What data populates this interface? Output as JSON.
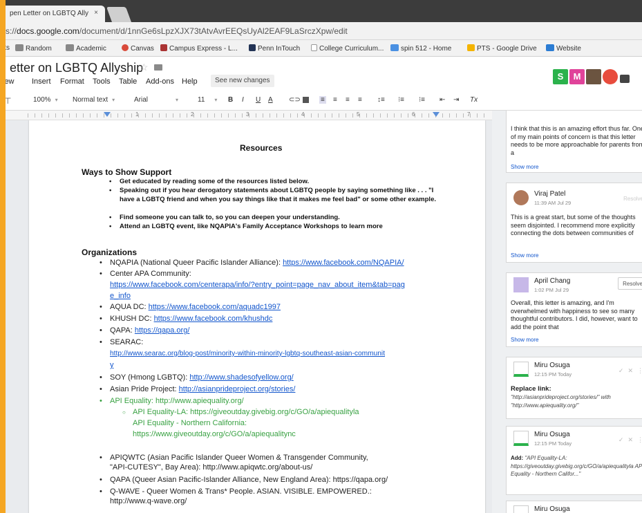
{
  "browser": {
    "tab_title": "pen Letter on LGBTQ Ally",
    "tab_close": "×",
    "url_prefix": "s://",
    "url_host": "docs.google.com",
    "url_path": "/document/d/1nnGe6sLpzXJX73tAtvAvrEEQsUyAl2EAF9LaSrczXpw/edit",
    "bookmarks": [
      "ks",
      "Random",
      "Academic",
      "Canvas",
      "Campus Express - L...",
      "Penn InTouch",
      "College Curriculum...",
      "spin 512 - Home",
      "PTS - Google Drive",
      "Website"
    ]
  },
  "docs": {
    "title": "etter on LGBTQ Allyship",
    "menus": [
      "iew",
      "Insert",
      "Format",
      "Tools",
      "Table",
      "Add-ons",
      "Help"
    ],
    "see_changes": "See new changes",
    "toolbar": {
      "zoom": "100%",
      "style": "Normal text",
      "font": "Arial",
      "size": "11"
    },
    "ruler_numbers": [
      "1",
      "2",
      "3",
      "4",
      "5",
      "6",
      "7"
    ],
    "avatars": [
      {
        "letter": "S",
        "color": "#2bb24c"
      },
      {
        "letter": "M",
        "color": "#e0439a"
      },
      {
        "letter": "",
        "color": "#6b5440"
      },
      {
        "letter": "",
        "color": "#e84c3d"
      }
    ]
  },
  "document": {
    "heading": "Resources",
    "support_title": "Ways to Show Support",
    "support_items": [
      "Get educated by reading some of the resources listed below.",
      "Speaking out if you hear derogatory statements about LGBTQ people by saying something like . . . \"I have a LGBTQ friend and when you say things like that it makes me feel bad\" or some other example.",
      "Find someone you can talk to, so you can deepen your understanding.",
      "Attend an LGBTQ event, like NQAPIA's Family Acceptance Workshops to learn more"
    ],
    "org_title": "Organizations",
    "orgs": [
      {
        "text": "NQAPIA (National Queer Pacific Islander Alliance): ",
        "link": "https://www.facebook.com/NQAPIA/"
      },
      {
        "text": "Center APA Community:",
        "link": ""
      },
      {
        "text": "",
        "link": "https://www.facebook.com/centerapa/info/?entry_point=page_nav_about_item&tab=pag"
      },
      {
        "text": "",
        "link": "e_info"
      },
      {
        "text": "AQUA DC: ",
        "link": "https://www.facebook.com/aquadc1997"
      },
      {
        "text": "KHUSH DC: ",
        "link": "https://www.facebook.com/khushdc"
      },
      {
        "text": "QAPA: ",
        "link": "https://qapa.org/"
      },
      {
        "text": "SEARAC:",
        "link": ""
      },
      {
        "text": "",
        "link": "http://www.searac.org/blog-post/minority-within-minority-lgbtq-southeast-asian-communit"
      },
      {
        "text": "",
        "link": "y"
      },
      {
        "text": "SOY (Hmong LGBTQ): ",
        "link": "http://www.shadesofyellow.org/"
      },
      {
        "text": "Asian Pride Project: ",
        "link": "http://asianprideproject.org/stories/"
      },
      {
        "text": "API Equality: ",
        "link": "http://www.apiequality.org/"
      }
    ],
    "sub_items": [
      "API Equality-LA: https://giveoutday.givebig.org/c/GO/a/apiequalityla",
      "API Equality - Northern California:",
      "https://www.giveoutday.org/c/GO/a/apiequalitync"
    ],
    "orgs_bottom": [
      "APIQWTC (Asian Pacific Islander Queer Women & Transgender Community,",
      "\"API-CUTESY\", Bay Area): http://www.apiqwtc.org/about-us/",
      "QAPA (Queer Asian Pacific-Islander Alliance, New England Area): https://qapa.org/",
      "Q-WAVE - Queer Women & Trans* People. ASIAN. VISIBLE. EMPOWERED.:",
      "http://www.q-wave.org/"
    ]
  },
  "comments": [
    {
      "name": "",
      "time": "",
      "body": "I think that this is an amazing effort thus far. One of my main points of concern is that this letter needs to be more approachable for parents from a",
      "show_more": "Show more"
    },
    {
      "name": "Viraj Patel",
      "time": "11:39 AM Jul 29",
      "resolve": "Resolve",
      "body": "This is a great start, but some of the thoughts seem disjointed. I recommend more explicitly connecting the dots between communities of",
      "show_more": "Show more"
    },
    {
      "name": "April Chang",
      "time": "1:02 PM Jul 29",
      "resolve": "Resolve",
      "body": "Overall, this letter is amazing, and I'm overwhelmed with happiness to see so many thoughtful contributors. I did, however, want to add the point that",
      "show_more": "Show more"
    },
    {
      "name": "Miru Osuga",
      "time": "12:15 PM Today",
      "label": "Replace link:",
      "body": "\"http://asianprideproject.org/stories/\" with \"http://www.apiequality.org/\""
    },
    {
      "name": "Miru Osuga",
      "time": "12:15 PM Today",
      "label": "Add:",
      "body": "\"API Equality-LA: https://giveoutday.givebig.org/c/GO/a/apiequalityla API Equality - Northern Califor...\""
    },
    {
      "name": "Miru Osuga",
      "time": "",
      "body": ""
    }
  ]
}
